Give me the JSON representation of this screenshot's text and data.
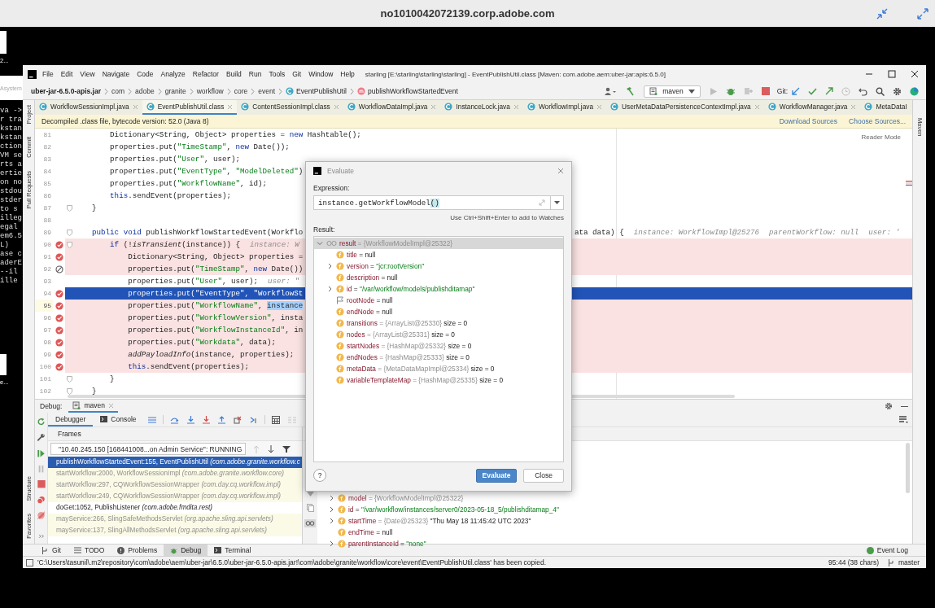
{
  "remote_title": "no1010042072139.corp.adobe.com",
  "desktop": {
    "top_label": "2...",
    "panel_label": "Asystem",
    "terminal_lines": [
      "va ->",
      "r tra",
      "kstan",
      "kstan",
      "ction",
      "VM se",
      "rts a",
      "ertie",
      "on no",
      "stdou",
      "stder",
      "to s",
      "illeg",
      "egal",
      "em6.5",
      "L)",
      "ase c",
      "aderE",
      "--il",
      "ille"
    ],
    "bottom_label": "e..."
  },
  "ide": {
    "title": "starling [E:\\starling\\starling\\starling] - EventPublishUtil.class [Maven: com.adobe.aem:uber-jar:apis:6.5.0]",
    "menu": [
      "File",
      "Edit",
      "View",
      "Navigate",
      "Code",
      "Analyze",
      "Refactor",
      "Build",
      "Run",
      "Tools",
      "Git",
      "Window",
      "Help"
    ],
    "breadcrumb": [
      {
        "label": "uber-jar-6.5.0-apis.jar",
        "kind": "jar"
      },
      {
        "label": "com",
        "kind": "package"
      },
      {
        "label": "adobe",
        "kind": "package"
      },
      {
        "label": "granite",
        "kind": "package"
      },
      {
        "label": "workflow",
        "kind": "package"
      },
      {
        "label": "core",
        "kind": "package"
      },
      {
        "label": "event",
        "kind": "package"
      },
      {
        "label": "EventPublishUtil",
        "kind": "class"
      },
      {
        "label": "publishWorkflowStartedEvent",
        "kind": "method"
      }
    ],
    "run_config": "maven",
    "git_label": "Git:",
    "left_tools": [
      "Project",
      "Commit",
      "Pull Requests"
    ],
    "left_tools_bottom": [
      "Structure",
      "Favorites"
    ],
    "right_tools": [
      "Maven"
    ],
    "tabs": [
      {
        "label": "WorkflowSessionImpl.java",
        "selected": false,
        "closable": true
      },
      {
        "label": "EventPublishUtil.class",
        "selected": true,
        "closable": true
      },
      {
        "label": "ContentSessionImpl.class",
        "selected": false,
        "closable": true
      },
      {
        "label": "WorkflowDataImpl.java",
        "selected": false,
        "closable": true
      },
      {
        "label": "InstanceLock.java",
        "selected": false,
        "closable": true
      },
      {
        "label": "WorkflowImpl.java",
        "selected": false,
        "closable": true
      },
      {
        "label": "UserMetaDataPersistenceContextImpl.java",
        "selected": false,
        "closable": true
      },
      {
        "label": "WorkflowManager.java",
        "selected": false,
        "closable": true
      },
      {
        "label": "MetaDataI",
        "selected": false,
        "closable": false
      }
    ],
    "banner": {
      "text": "Decompiled .class file, bytecode version: 52.0 (Java 8)",
      "links": [
        "Download Sources",
        "Choose Sources..."
      ]
    },
    "reader_mode": "Reader Mode",
    "code": [
      {
        "number": "81",
        "breakpoint": false,
        "current": false,
        "caret": false,
        "fold": false,
        "segments": [
          {
            "text": "        Dictionary<String, Object> properties = "
          },
          {
            "text": "new",
            "kind": "kw"
          },
          {
            "text": " Hashtable();"
          }
        ]
      },
      {
        "number": "82",
        "breakpoint": false,
        "current": false,
        "caret": false,
        "fold": false,
        "segments": [
          {
            "text": "        properties.put("
          },
          {
            "text": "\"TimeStamp\"",
            "kind": "str"
          },
          {
            "text": ", "
          },
          {
            "text": "new",
            "kind": "kw"
          },
          {
            "text": " Date());"
          }
        ]
      },
      {
        "number": "83",
        "breakpoint": false,
        "current": false,
        "caret": false,
        "fold": false,
        "segments": [
          {
            "text": "        properties.put("
          },
          {
            "text": "\"User\"",
            "kind": "str"
          },
          {
            "text": ", user);"
          }
        ]
      },
      {
        "number": "84",
        "breakpoint": false,
        "current": false,
        "caret": false,
        "fold": false,
        "segments": [
          {
            "text": "        properties.put("
          },
          {
            "text": "\"EventType\"",
            "kind": "str"
          },
          {
            "text": ", "
          },
          {
            "text": "\"ModelDeleted\"",
            "kind": "str"
          },
          {
            "text": ")"
          }
        ]
      },
      {
        "number": "85",
        "breakpoint": false,
        "current": false,
        "caret": false,
        "fold": false,
        "segments": [
          {
            "text": "        properties.put("
          },
          {
            "text": "\"WorkflowName\"",
            "kind": "str"
          },
          {
            "text": ", id);"
          }
        ]
      },
      {
        "number": "86",
        "breakpoint": false,
        "current": false,
        "caret": false,
        "fold": false,
        "segments": [
          {
            "text": "        this",
            "kind": "kw"
          },
          {
            "text": ".sendEvent(properties);"
          }
        ]
      },
      {
        "number": "87",
        "breakpoint": false,
        "current": false,
        "caret": false,
        "fold": true,
        "segments": [
          {
            "text": "    }"
          }
        ]
      },
      {
        "number": "88",
        "breakpoint": false,
        "current": false,
        "caret": false,
        "fold": false
      },
      {
        "number": "89",
        "breakpoint": false,
        "current": false,
        "caret": false,
        "fold": true,
        "segments": [
          {
            "text": "    public void",
            "kind": "kw"
          },
          {
            "text": " publishWorkflowStartedEvent(Workflo"
          }
        ],
        "tail": [
          {
            "text": "ata data) {"
          },
          {
            "text": "instance: WorkflowImpl@25276",
            "kind": "hint"
          },
          {
            "text": "parentWorkflow: null",
            "kind": "hint"
          },
          {
            "text": "user: '",
            "kind": "hint"
          }
        ]
      },
      {
        "number": "90",
        "breakpoint": true,
        "muted": false,
        "current": false,
        "caret": false,
        "fold": true,
        "segments": [
          {
            "text": "        if",
            "kind": "kw"
          },
          {
            "text": " (!"
          },
          {
            "text": "isTransient",
            "kind": "it"
          },
          {
            "text": "(instance)) {"
          },
          {
            "text": "instance: W",
            "kind": "hint"
          }
        ]
      },
      {
        "number": "91",
        "breakpoint": true,
        "muted": false,
        "current": false,
        "caret": false,
        "fold": false,
        "segments": [
          {
            "text": "            Dictionary<String, Object> properties ="
          }
        ]
      },
      {
        "number": "92",
        "breakpoint": true,
        "muted": true,
        "current": false,
        "caret": false,
        "fold": false,
        "segments": [
          {
            "text": "            properties.put("
          },
          {
            "text": "\"TimeStamp\"",
            "kind": "str"
          },
          {
            "text": ", "
          },
          {
            "text": "new",
            "kind": "kw"
          },
          {
            "text": " Date())"
          }
        ]
      },
      {
        "number": "93",
        "breakpoint": false,
        "current": false,
        "caret": false,
        "fold": false,
        "segments": [
          {
            "text": "            properties.put("
          },
          {
            "text": "\"User\"",
            "kind": "str"
          },
          {
            "text": ", user);"
          },
          {
            "text": "user: \"",
            "kind": "hint"
          }
        ]
      },
      {
        "number": "94",
        "breakpoint": true,
        "muted": false,
        "current": true,
        "caret": false,
        "fold": false,
        "segments": [
          {
            "text": "            properties.put("
          },
          {
            "text": "\"EventType\"",
            "kind": "str"
          },
          {
            "text": ", "
          },
          {
            "text": "\"WorkflowSt",
            "kind": "str"
          }
        ]
      },
      {
        "number": "95",
        "breakpoint": true,
        "muted": false,
        "current": false,
        "caret": true,
        "fold": false,
        "segments": [
          {
            "text": "            properties.put("
          },
          {
            "text": "\"WorkflowName\"",
            "kind": "str"
          },
          {
            "text": ", "
          },
          {
            "text": "instance",
            "kind": "sel"
          }
        ]
      },
      {
        "number": "96",
        "breakpoint": true,
        "muted": false,
        "current": false,
        "caret": false,
        "fold": false,
        "segments": [
          {
            "text": "            properties.put("
          },
          {
            "text": "\"WorkflowVersion\"",
            "kind": "str"
          },
          {
            "text": ", insta"
          }
        ]
      },
      {
        "number": "97",
        "breakpoint": true,
        "muted": false,
        "current": false,
        "caret": false,
        "fold": false,
        "segments": [
          {
            "text": "            properties.put("
          },
          {
            "text": "\"WorkflowInstanceId\"",
            "kind": "str"
          },
          {
            "text": ", in"
          }
        ]
      },
      {
        "number": "98",
        "breakpoint": true,
        "muted": false,
        "current": false,
        "caret": false,
        "fold": false,
        "segments": [
          {
            "text": "            properties.put("
          },
          {
            "text": "\"Workdata\"",
            "kind": "str"
          },
          {
            "text": ", data);"
          }
        ]
      },
      {
        "number": "99",
        "breakpoint": true,
        "muted": false,
        "current": false,
        "caret": false,
        "fold": false,
        "segments": [
          {
            "text": "            addPayloadInfo",
            "kind": "it"
          },
          {
            "text": "(instance, properties);"
          }
        ]
      },
      {
        "number": "100",
        "breakpoint": true,
        "muted": false,
        "current": false,
        "caret": false,
        "fold": false,
        "segments": [
          {
            "text": "            this",
            "kind": "kw"
          },
          {
            "text": ".sendEvent(properties);"
          }
        ]
      },
      {
        "number": "101",
        "breakpoint": false,
        "current": false,
        "caret": false,
        "fold": true,
        "segments": [
          {
            "text": "        }"
          }
        ]
      },
      {
        "number": "102",
        "breakpoint": false,
        "current": false,
        "caret": false,
        "fold": true,
        "segments": [
          {
            "text": "    }"
          }
        ]
      }
    ],
    "debug": {
      "title": "Debug:",
      "session": "maven",
      "tabs": [
        {
          "label": "Debugger",
          "kind": "debugger",
          "selected": true
        },
        {
          "label": "Console",
          "kind": "console",
          "selected": false
        }
      ],
      "frames_label": "Frames",
      "thread": "\"10.40.245.150 [168441008...on Admin Service\": RUNNING",
      "frames": [
        {
          "method": "publishWorkflowStartedEvent:155, EventPublishUtil",
          "pkg": "(com.adobe.granite.workflow.c",
          "selected": true,
          "library": false
        },
        {
          "method": "startWorkflow:2000, WorkflowSessionImpl",
          "pkg": "(com.adobe.granite.workflow.core)",
          "selected": false,
          "library": true
        },
        {
          "method": "startWorkflow:297, CQWorkflowSessionWrapper",
          "pkg": "(com.day.cq.workflow.impl)",
          "selected": false,
          "library": true
        },
        {
          "method": "startWorkflow:249, CQWorkflowSessionWrapper",
          "pkg": "(com.day.cq.workflow.impl)",
          "selected": false,
          "library": true
        },
        {
          "method": "doGet:1052, PublishListener",
          "pkg": "(com.adobe.fmdita.rest)",
          "selected": false,
          "library": false
        },
        {
          "method": "mayService:266, SlingSafeMethodsServlet",
          "pkg": "(org.apache.sling.api.servlets)",
          "selected": false,
          "library": true
        },
        {
          "method": "mayService:137, SlingAllMethodsServlet",
          "pkg": "(org.apache.sling.api.servlets)",
          "selected": false,
          "library": true
        }
      ],
      "variables": [
        {
          "name": "model",
          "kind": "field",
          "expandable": true,
          "parts": [
            {
              "text": "= {WorkflowModelImpl@25322}",
              "kind": "ref"
            }
          ]
        },
        {
          "name": "id",
          "kind": "field",
          "expandable": true,
          "parts": [
            {
              "text": "=",
              "kind": "plain"
            },
            {
              "text": "\"/var/workflow/instances/server0/2023-05-18_5/publishditamap_4\"",
              "kind": "str"
            }
          ]
        },
        {
          "name": "startTime",
          "kind": "field",
          "expandable": true,
          "parts": [
            {
              "text": "= {Date@25323}",
              "kind": "ref"
            },
            {
              "text": "\"Thu May 18 11:45:42 UTC 2023\"",
              "kind": "plain"
            }
          ]
        },
        {
          "name": "endTime",
          "kind": "field",
          "expandable": false,
          "parts": [
            {
              "text": "= null",
              "kind": "plain"
            }
          ]
        },
        {
          "name": "parentInstanceId",
          "kind": "field",
          "expandable": true,
          "parts": [
            {
              "text": "=",
              "kind": "plain"
            },
            {
              "text": "\"none\"",
              "kind": "str"
            }
          ]
        }
      ]
    },
    "bottom_tabs": [
      {
        "label": "Git",
        "kind": "git",
        "selected": false
      },
      {
        "label": "TODO",
        "kind": "todo",
        "selected": false
      },
      {
        "label": "Problems",
        "kind": "problems",
        "selected": false
      },
      {
        "label": "Debug",
        "kind": "debug",
        "selected": true
      },
      {
        "label": "Terminal",
        "kind": "terminal",
        "selected": false
      }
    ],
    "event_log": "Event Log",
    "status": {
      "message": "'C:\\Users\\tasunil\\.m2\\repository\\com\\adobe\\aem\\uber-jar\\6.5.0\\uber-jar-6.5.0-apis.jar!\\com\\adobe\\granite\\workflow\\core\\event\\EventPublishUtil.class' has been copied.",
      "position": "95:44 (38 chars)",
      "branch": "master"
    }
  },
  "evaluate": {
    "title": "Evaluate",
    "expression_label": "Expression:",
    "expression": {
      "text": "instance.getWorkflowModel",
      "matched": "()"
    },
    "hint": "Use Ctrl+Shift+Enter to add to Watches",
    "result_label": "Result:",
    "result": {
      "name": "result",
      "kind": "watch",
      "expanded": true,
      "selected": true,
      "parts": [
        {
          "text": "= {WorkflowModelImpl@25322}",
          "kind": "ref"
        }
      ],
      "children": [
        {
          "name": "title",
          "kind": "field",
          "expandable": false,
          "parts": [
            {
              "text": "= null",
              "kind": "plain"
            }
          ]
        },
        {
          "name": "version",
          "kind": "field",
          "expandable": true,
          "parts": [
            {
              "text": "=",
              "kind": "plain"
            },
            {
              "text": "\"jcr:rootVersion\"",
              "kind": "str"
            }
          ]
        },
        {
          "name": "description",
          "kind": "field",
          "expandable": false,
          "parts": [
            {
              "text": "= null",
              "kind": "plain"
            }
          ]
        },
        {
          "name": "id",
          "kind": "field",
          "expandable": true,
          "parts": [
            {
              "text": "=",
              "kind": "plain"
            },
            {
              "text": "\"/var/workflow/models/publishditamap\"",
              "kind": "str"
            }
          ]
        },
        {
          "name": "rootNode",
          "kind": "flag",
          "expandable": false,
          "parts": [
            {
              "text": "= null",
              "kind": "plain"
            }
          ]
        },
        {
          "name": "endNode",
          "kind": "field",
          "expandable": false,
          "parts": [
            {
              "text": "= null",
              "kind": "plain"
            }
          ]
        },
        {
          "name": "transitions",
          "kind": "field",
          "expandable": false,
          "parts": [
            {
              "text": "= {ArrayList@25330}",
              "kind": "ref"
            },
            {
              "text": "size = 0",
              "kind": "plain"
            }
          ]
        },
        {
          "name": "nodes",
          "kind": "field",
          "expandable": false,
          "parts": [
            {
              "text": "= {ArrayList@25331}",
              "kind": "ref"
            },
            {
              "text": "size = 0",
              "kind": "plain"
            }
          ]
        },
        {
          "name": "startNodes",
          "kind": "field",
          "expandable": false,
          "parts": [
            {
              "text": "= {HashMap@25332}",
              "kind": "ref"
            },
            {
              "text": "size = 0",
              "kind": "plain"
            }
          ]
        },
        {
          "name": "endNodes",
          "kind": "field",
          "expandable": false,
          "parts": [
            {
              "text": "= {HashMap@25333}",
              "kind": "ref"
            },
            {
              "text": "size = 0",
              "kind": "plain"
            }
          ]
        },
        {
          "name": "metaData",
          "kind": "field",
          "expandable": false,
          "parts": [
            {
              "text": "= {MetaDataMapImpl@25334}",
              "kind": "ref"
            },
            {
              "text": "size = 0",
              "kind": "plain"
            }
          ]
        },
        {
          "name": "variableTemplateMap",
          "kind": "field",
          "expandable": false,
          "parts": [
            {
              "text": "= {HashMap@25335}",
              "kind": "ref"
            },
            {
              "text": "size = 0",
              "kind": "plain"
            }
          ]
        }
      ]
    },
    "help": "?",
    "buttons": [
      {
        "label": "Evaluate",
        "primary": true
      },
      {
        "label": "Close",
        "primary": false
      }
    ]
  }
}
